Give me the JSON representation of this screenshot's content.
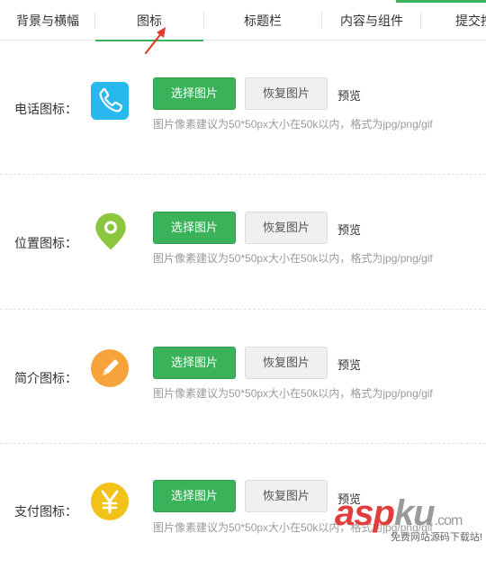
{
  "tabs": [
    {
      "label": "背景与横幅"
    },
    {
      "label": "图标"
    },
    {
      "label": "标题栏"
    },
    {
      "label": "内容与组件"
    },
    {
      "label": "提交按"
    }
  ],
  "colors": {
    "accent": "#3ab25a"
  },
  "rows": [
    {
      "label": "电话图标：",
      "icon": "phone-icon",
      "icon_color": "#29b7ef",
      "select_label": "选择图片",
      "restore_label": "恢复图片",
      "preview_label": "预览",
      "hint": "图片像素建议为50*50px大小在50k以内，格式为jpg/png/gif"
    },
    {
      "label": "位置图标：",
      "icon": "location-pin-icon",
      "icon_color": "#8cc63f",
      "select_label": "选择图片",
      "restore_label": "恢复图片",
      "preview_label": "预览",
      "hint": "图片像素建议为50*50px大小在50k以内，格式为jpg/png/gif"
    },
    {
      "label": "简介图标：",
      "icon": "pencil-icon",
      "icon_color": "#f7a23b",
      "select_label": "选择图片",
      "restore_label": "恢复图片",
      "preview_label": "预览",
      "hint": "图片像素建议为50*50px大小在50k以内，格式为jpg/png/gif"
    },
    {
      "label": "支付图标：",
      "icon": "yen-icon",
      "icon_color": "#f2c218",
      "select_label": "选择图片",
      "restore_label": "恢复图片",
      "preview_label": "预览",
      "hint": "图片像素建议为50*50px大小在50k以内，格式为jpg/png/gif"
    }
  ],
  "watermark": {
    "brand": "aspku",
    "domain_suffix": ".com",
    "sub": "免费网站源码下载站!"
  }
}
